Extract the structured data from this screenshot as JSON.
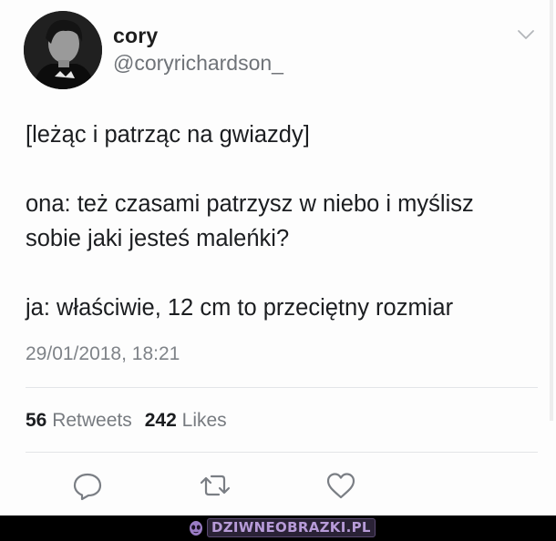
{
  "author": {
    "display_name": "cory",
    "handle": "@coryrichardson_"
  },
  "tweet": {
    "lines": [
      "[leżąc i patrząc na gwiazdy]",
      "ona: też czasami patrzysz w niebo i myślisz",
      "sobie jaki jesteś maleńki?",
      "ja: właściwie, 12 cm to przeciętny rozmiar"
    ],
    "timestamp": "29/01/2018, 18:21"
  },
  "stats": {
    "retweets_count": "56",
    "retweets_label": "Retweets",
    "likes_count": "242",
    "likes_label": "Likes"
  },
  "actions": {
    "icons": [
      "reply-icon",
      "retweet-icon",
      "like-icon"
    ]
  },
  "watermark": {
    "text": "DZIWNEOBRAZKI.PL",
    "color": "#b79bd8"
  },
  "colors": {
    "text": "#14171a",
    "secondary": "#777b80",
    "icon": "#7a7e84"
  }
}
